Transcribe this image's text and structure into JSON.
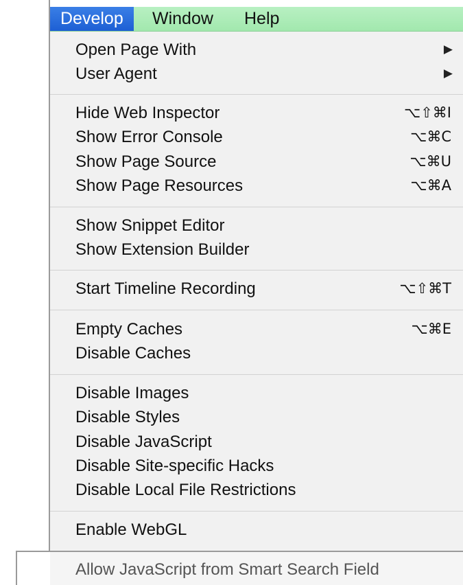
{
  "menubar": {
    "develop": "Develop",
    "window": "Window",
    "help": "Help"
  },
  "menu": {
    "open_page_with": "Open Page With",
    "user_agent": "User Agent",
    "hide_web_inspector": "Hide Web Inspector",
    "hide_web_inspector_shortcut": "⌥⇧⌘I",
    "show_error_console": "Show Error Console",
    "show_error_console_shortcut": "⌥⌘C",
    "show_page_source": "Show Page Source",
    "show_page_source_shortcut": "⌥⌘U",
    "show_page_resources": "Show Page Resources",
    "show_page_resources_shortcut": "⌥⌘A",
    "show_snippet_editor": "Show Snippet Editor",
    "show_extension_builder": "Show Extension Builder",
    "start_timeline_recording": "Start Timeline Recording",
    "start_timeline_recording_shortcut": "⌥⇧⌘T",
    "empty_caches": "Empty Caches",
    "empty_caches_shortcut": "⌥⌘E",
    "disable_caches": "Disable Caches",
    "disable_images": "Disable Images",
    "disable_styles": "Disable Styles",
    "disable_javascript": "Disable JavaScript",
    "disable_site_specific_hacks": "Disable Site-specific Hacks",
    "disable_local_file_restrictions": "Disable Local File Restrictions",
    "enable_webgl": "Enable WebGL",
    "allow_javascript_smart_search": "Allow JavaScript from Smart Search Field"
  },
  "icons": {
    "submenu_arrow": "submenu-arrow-icon"
  },
  "colors": {
    "menubar_bg": "#a8eab3",
    "active_bg": "#2a6fdc",
    "menu_bg": "#f1f1f1"
  }
}
